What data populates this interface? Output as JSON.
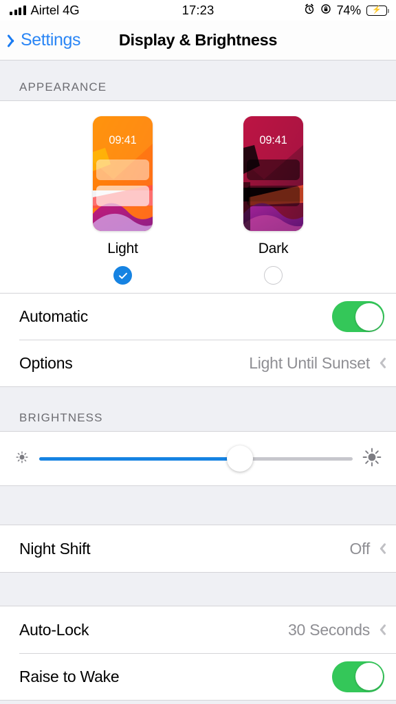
{
  "status_bar": {
    "carrier": "Airtel 4G",
    "signal_bars": 4,
    "time": "17:23",
    "battery_percent": "74%",
    "alarm_icon": "alarm-clock-icon",
    "rotation_lock_icon": "rotation-lock-icon",
    "battery_icon": "battery-charging-icon",
    "charging": true
  },
  "nav": {
    "back_label": "Settings",
    "title": "Display & Brightness"
  },
  "appearance": {
    "header": "APPEARANCE",
    "options": [
      {
        "label": "Light",
        "preview_time": "09:41",
        "selected": true
      },
      {
        "label": "Dark",
        "preview_time": "09:41",
        "selected": false
      }
    ],
    "rows": [
      {
        "label": "Automatic",
        "control": "toggle",
        "value": "On"
      },
      {
        "label": "Options",
        "control": "disclosure",
        "value": "Light Until Sunset"
      }
    ]
  },
  "brightness": {
    "header": "BRIGHTNESS",
    "low_icon": "sun-min-icon",
    "high_icon": "sun-max-icon",
    "level_percent": 64
  },
  "night_shift": {
    "rows": [
      {
        "label": "Night Shift",
        "control": "disclosure",
        "value": "Off"
      }
    ]
  },
  "lock": {
    "rows": [
      {
        "label": "Auto-Lock",
        "control": "disclosure",
        "value": "30 Seconds"
      },
      {
        "label": "Raise to Wake",
        "control": "toggle",
        "value": "On"
      }
    ]
  },
  "colors": {
    "accent_blue": "#1683e2",
    "nav_blue": "#2b86f5",
    "toggle_green": "#34c759",
    "group_bg": "#eff0f4",
    "secondary_text": "#8e8e93"
  }
}
